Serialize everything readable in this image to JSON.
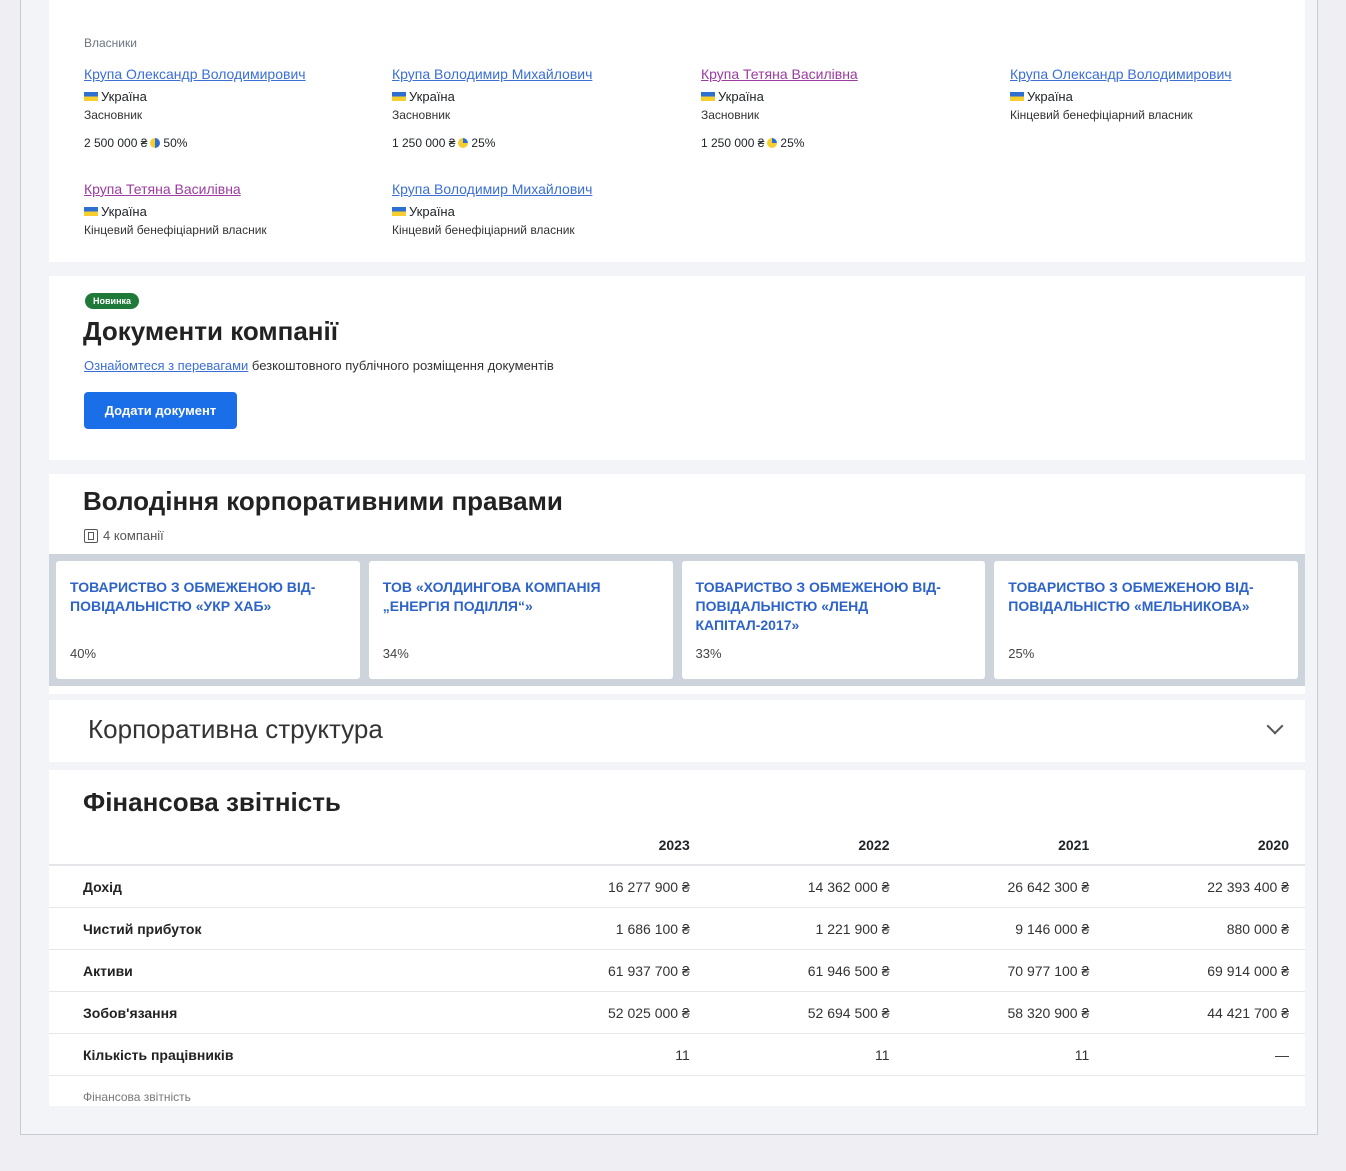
{
  "owners": {
    "section_label": "Власники",
    "items": [
      {
        "name": "Крупа Олександр Володимирович",
        "country": "Україна",
        "role": "Засновник",
        "share": "2 500 000 ₴",
        "percent": "50%"
      },
      {
        "name": "Крупа Володимир Михайлович",
        "country": "Україна",
        "role": "Засновник",
        "share": "1 250 000 ₴",
        "percent": "25%"
      },
      {
        "name": "Крупа Тетяна Василівна",
        "country": "Україна",
        "role": "Засновник",
        "share": "1 250 000 ₴",
        "percent": "25%"
      },
      {
        "name": "Крупа Олександр Володимирович",
        "country": "Україна",
        "role": "Кінцевий бенефіціарний власник"
      },
      {
        "name": "Крупа Тетяна Василівна",
        "country": "Україна",
        "role": "Кінцевий бенефіціарний власник"
      },
      {
        "name": "Крупа Володимир Михайлович",
        "country": "Україна",
        "role": "Кінцевий бенефіціарний власник"
      }
    ]
  },
  "documents": {
    "badge": "Новинка",
    "title": "Документи компанії",
    "link_text": "Ознайомтеся з перевагами",
    "sub_text": " безкоштовного публічного розміщення документів",
    "button": "Додати документ"
  },
  "corporate_rights": {
    "title": "Володіння корпоративними правами",
    "count": "4 компанії",
    "companies": [
      {
        "name": "Товариство з обмеженою від­повідальністю «УКР ХАБ»",
        "percent": "40%"
      },
      {
        "name": "ТОВ «ХОЛДИНГОВА КОМПАНІЯ „ЕНЕРГІЯ ПОДІЛЛЯ“»",
        "percent": "34%"
      },
      {
        "name": "Товариство з обмеженою від­повідальністю «ЛЕНД КАПІТАЛ-2017»",
        "percent": "33%"
      },
      {
        "name": "Товариство з обмеженою від­повідальністю «МЕЛЬНИКОВА»",
        "percent": "25%"
      }
    ]
  },
  "structure": {
    "title": "Корпоративна структура"
  },
  "financials": {
    "title": "Фінансова звітність",
    "years": [
      "2023",
      "2022",
      "2021",
      "2020"
    ],
    "rows": [
      {
        "label": "Дохід",
        "values": [
          "16 277 900 ₴",
          "14 362 000 ₴",
          "26 642 300 ₴",
          "22 393 400 ₴"
        ]
      },
      {
        "label": "Чистий прибуток",
        "values": [
          "1 686 100 ₴",
          "1 221 900 ₴",
          "9 146 000 ₴",
          "880 000 ₴"
        ]
      },
      {
        "label": "Активи",
        "values": [
          "61 937 700 ₴",
          "61 946 500 ₴",
          "70 977 100 ₴",
          "69 914 000 ₴"
        ]
      },
      {
        "label": "Зобов'язання",
        "values": [
          "52 025 000 ₴",
          "52 694 500 ₴",
          "58 320 900 ₴",
          "44 421 700 ₴"
        ]
      },
      {
        "label": "Кількість працівників",
        "values": [
          "11",
          "11",
          "11",
          "—"
        ]
      }
    ],
    "note": "Фінансова звітність"
  }
}
